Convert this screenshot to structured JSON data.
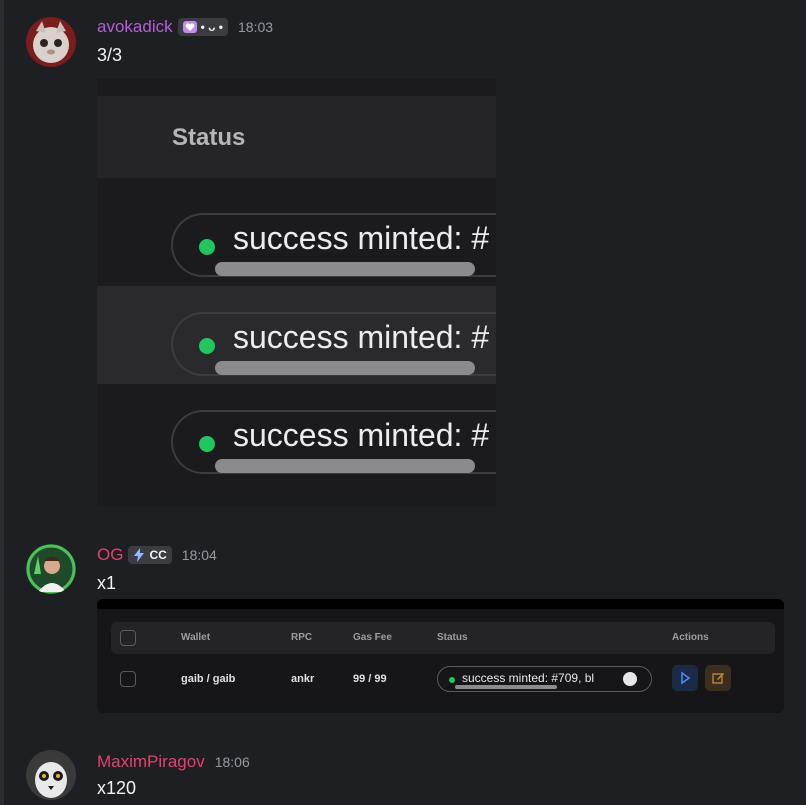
{
  "messages": [
    {
      "username": "avokadick",
      "username_color": "#b55fd6",
      "tag": "• ᴗ •",
      "tag_icon": "heart-icon",
      "time": "18:03",
      "text": "3/3",
      "image": {
        "header": "Status",
        "rows": [
          {
            "status": "success minted: #"
          },
          {
            "status": "success minted: #"
          },
          {
            "status": "success minted: #"
          }
        ]
      }
    },
    {
      "username": "OG",
      "username_color": "#e0436d",
      "tag": "CC",
      "tag_icon": "lightning-icon",
      "time": "18:04",
      "text": "x1",
      "table": {
        "columns": [
          "Wallet",
          "RPC",
          "Gas Fee",
          "Status",
          "Actions"
        ],
        "rows": [
          {
            "wallet": "gaib / gaib",
            "rpc": "ankr",
            "gas_fee": "99 / 99",
            "status": "success minted: #709, bl"
          }
        ]
      }
    },
    {
      "username": "MaximPiragov",
      "username_color": "#e0436d",
      "time": "18:06",
      "text": "x120"
    }
  ],
  "colors": {
    "background": "#1e1f22",
    "success_dot": "#22c55e"
  }
}
